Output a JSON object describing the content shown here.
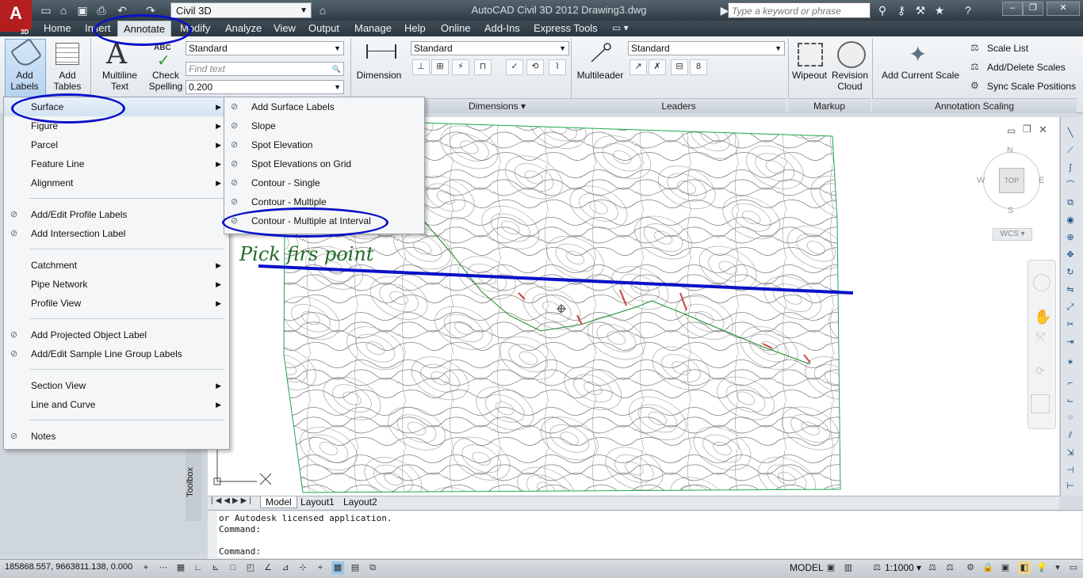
{
  "app": {
    "logo": "A",
    "logo_sub": "3D",
    "workspace": "Civil 3D",
    "window_title": "AutoCAD Civil 3D 2012    Drawing3.dwg",
    "search_placeholder": "Type a keyword or phrase"
  },
  "menubar": {
    "tabs": [
      "Home",
      "Insert",
      "Annotate",
      "Modify",
      "Analyze",
      "View",
      "Output",
      "Manage",
      "Help",
      "Online",
      "Add-Ins",
      "Express Tools"
    ],
    "active_tab": "Annotate"
  },
  "ribbon": {
    "add_labels": "Add Labels",
    "add_tables": "Add Tables",
    "multiline_text": "Multiline Text",
    "check_spelling": "Check Spelling",
    "text_style": "Standard",
    "find_text_placeholder": "Find text",
    "text_height": "0.200",
    "dimension": "Dimension",
    "dim_style": "Standard",
    "dimensions_panel": "Dimensions",
    "multileader": "Multileader",
    "leader_style": "Standard",
    "leaders_panel": "Leaders",
    "wipeout": "Wipeout",
    "revision_cloud": "Revision Cloud",
    "markup_panel": "Markup",
    "add_current_scale": "Add Current Scale",
    "scale_list": "Scale List",
    "add_delete_scales": "Add/Delete Scales",
    "sync_scale_positions": "Sync Scale Positions",
    "annotation_scaling_panel": "Annotation Scaling"
  },
  "label_menu": {
    "items": [
      {
        "label": "Surface",
        "submenu": true
      },
      {
        "label": "Figure",
        "submenu": true
      },
      {
        "label": "Parcel",
        "submenu": true
      },
      {
        "label": "Feature Line",
        "submenu": true
      },
      {
        "label": "Alignment",
        "submenu": true
      },
      {
        "label": "Add/Edit Profile Labels",
        "submenu": false
      },
      {
        "label": "Add Intersection Label",
        "submenu": false
      },
      {
        "label": "Catchment",
        "submenu": true
      },
      {
        "label": "Pipe Network",
        "submenu": true
      },
      {
        "label": "Profile View",
        "submenu": true
      },
      {
        "label": "Add Projected Object Label",
        "submenu": false
      },
      {
        "label": "Add/Edit Sample Line Group Labels",
        "submenu": false
      },
      {
        "label": "Section View",
        "submenu": true
      },
      {
        "label": "Line and Curve",
        "submenu": true
      },
      {
        "label": "Notes",
        "submenu": false
      }
    ]
  },
  "surface_submenu": {
    "items": [
      "Add Surface Labels",
      "Slope",
      "Spot Elevation",
      "Spot Elevations on Grid",
      "Contour - Single",
      "Contour - Multiple",
      "Contour - Multiple at Interval"
    ]
  },
  "annotation": {
    "handwritten": "Pick firs point"
  },
  "viewcube": {
    "n": "N",
    "s": "S",
    "e": "E",
    "w": "W",
    "top": "TOP",
    "wcs": "WCS"
  },
  "layout_tabs": [
    "Model",
    "Layout1",
    "Layout2"
  ],
  "command": {
    "lines": [
      "or Autodesk licensed application.",
      "Command:",
      "",
      "Command:"
    ]
  },
  "status": {
    "coordinates": "185868.557, 9663811.138, 0.000",
    "model": "MODEL",
    "scale": "1:1000"
  },
  "toolbox_label": "Toolbox",
  "colors": {
    "annotation_blue": "#0a11c8",
    "boundary_green": "#1aa84b",
    "alignment_green": "#1a8a2a",
    "contour_gray": "#5a5a5a"
  }
}
